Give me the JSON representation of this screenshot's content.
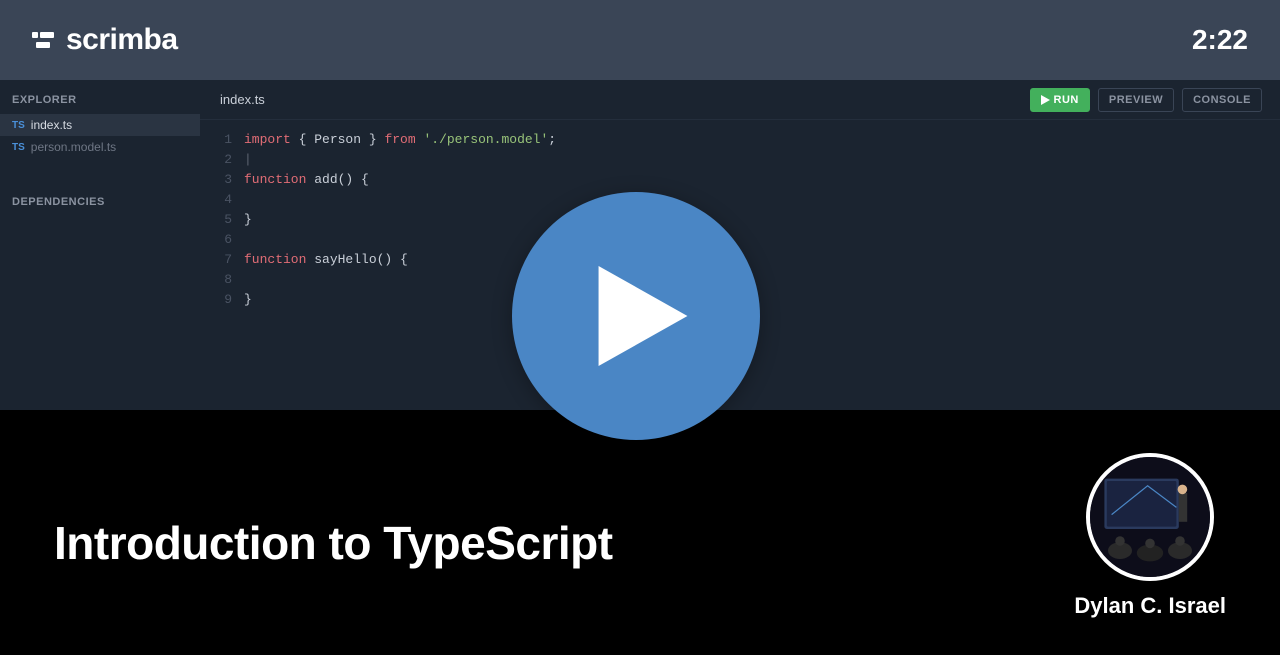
{
  "brand": "scrimba",
  "timer": "2:22",
  "sidebar": {
    "explorer_label": "EXPLORER",
    "dependencies_label": "DEPENDENCIES",
    "files": [
      {
        "badge": "TS",
        "name": "index.ts",
        "active": true
      },
      {
        "badge": "TS",
        "name": "person.model.ts",
        "active": false
      }
    ]
  },
  "editor": {
    "tab": "index.ts",
    "buttons": {
      "run": "RUN",
      "preview": "PREVIEW",
      "console": "CONSOLE"
    },
    "lines": [
      {
        "n": "1"
      },
      {
        "n": "2"
      },
      {
        "n": "3"
      },
      {
        "n": "4"
      },
      {
        "n": "5"
      },
      {
        "n": "6"
      },
      {
        "n": "7"
      },
      {
        "n": "8"
      },
      {
        "n": "9"
      }
    ],
    "code": {
      "l1_import": "import",
      "l1_mid": " { Person } ",
      "l1_from": "from",
      "l1_sp": " ",
      "l1_str": "'./person.model'",
      "l1_end": ";",
      "l2": "",
      "l3_fn": "function",
      "l3_rest": " add() {",
      "l4": "",
      "l5": "}",
      "l6": "",
      "l7_fn": "function",
      "l7_rest": " sayHello() {",
      "l8": "",
      "l9": "}"
    }
  },
  "footer": {
    "title": "Introduction to TypeScript",
    "author": "Dylan C. Israel"
  }
}
